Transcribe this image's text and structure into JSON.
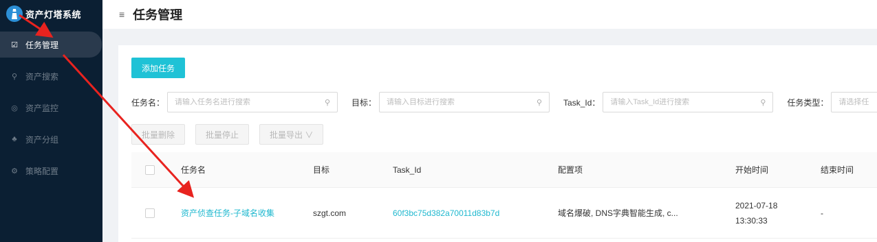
{
  "app": {
    "title": "资产灯塔系统",
    "logo_icon": "lighthouse-icon"
  },
  "sidebar": {
    "items": [
      {
        "label": "任务管理",
        "icon": "☑",
        "active": true
      },
      {
        "label": "资产搜索",
        "icon": "⚲",
        "active": false
      },
      {
        "label": "资产监控",
        "icon": "◎",
        "active": false
      },
      {
        "label": "资产分组",
        "icon": "♣",
        "active": false
      },
      {
        "label": "策略配置",
        "icon": "⚙",
        "active": false
      }
    ]
  },
  "header": {
    "title": "任务管理",
    "fold_icon": "≡"
  },
  "toolbar": {
    "add_label": "添加任务"
  },
  "filters": {
    "task_name_label": "任务名：",
    "task_name_placeholder": "请输入任务名进行搜索",
    "target_label": "目标：",
    "target_placeholder": "请输入目标进行搜索",
    "task_id_label": "Task_Id：",
    "task_id_placeholder": "请输入Task_Id进行搜索",
    "task_type_label": "任务类型：",
    "task_type_placeholder": "请选择任"
  },
  "bulk_actions": {
    "delete_label": "批量删除",
    "stop_label": "批量停止",
    "export_label": "批量导出 ∨"
  },
  "table": {
    "headers": [
      "任务名",
      "目标",
      "Task_Id",
      "配置项",
      "开始时间",
      "结束时间"
    ],
    "rows": [
      {
        "name": "资产侦查任务-子域名收集",
        "target": "szgt.com",
        "task_id": "60f3bc75d382a70011d83b7d",
        "config": "域名爆破, DNS字典智能生成, c...",
        "start_date": "2021-07-18",
        "start_time": "13:30:33",
        "end": "-"
      }
    ]
  },
  "colors": {
    "sidebar_bg": "#0b1f33",
    "accent": "#1fc2d6",
    "link": "#1fb8cf",
    "arrow": "#e8231f"
  }
}
